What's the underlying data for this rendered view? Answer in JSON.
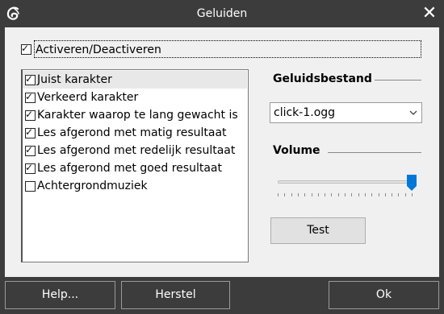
{
  "window": {
    "title": "Geluiden",
    "close_glyph": "✕"
  },
  "enable": {
    "label": "Activeren/Deactiveren",
    "checked": true
  },
  "sounds": {
    "items": [
      {
        "label": "Juist karakter",
        "checked": true
      },
      {
        "label": "Verkeerd karakter",
        "checked": true
      },
      {
        "label": "Karakter waarop te lang gewacht is",
        "checked": true
      },
      {
        "label": "Les afgerond met matig resultaat",
        "checked": true
      },
      {
        "label": "Les afgerond met redelijk resultaat",
        "checked": true
      },
      {
        "label": "Les afgerond met goed resultaat",
        "checked": true
      },
      {
        "label": "Achtergrondmuziek",
        "checked": false
      }
    ]
  },
  "sound_file": {
    "heading": "Geluidsbestand",
    "selected": "click-1.ogg"
  },
  "volume": {
    "heading": "Volume",
    "level": 1.0
  },
  "test_button": "Test",
  "footer": {
    "help": "Help...",
    "reset": "Herstel",
    "ok": "Ok"
  },
  "colors": {
    "accent": "#0078d7",
    "window_bg": "#3c3c3c",
    "panel_bg": "#f0f0f0"
  }
}
